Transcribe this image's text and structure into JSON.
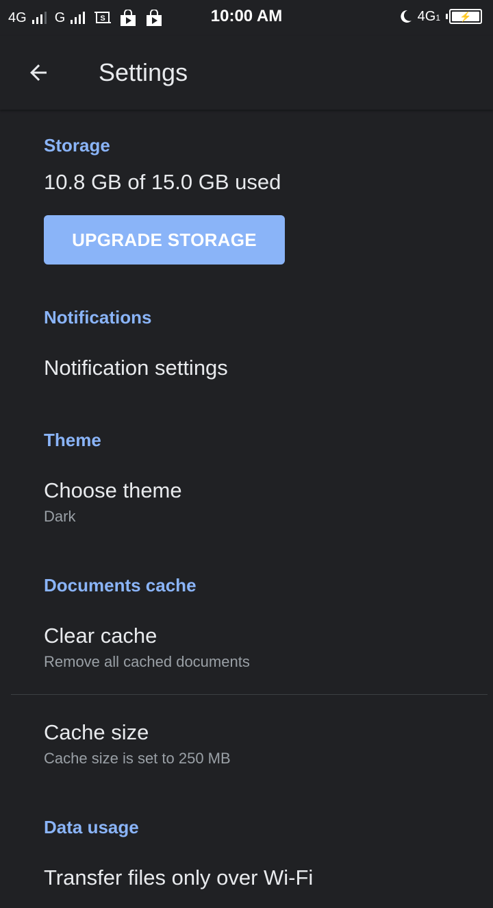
{
  "status_bar": {
    "network1": "4G",
    "network2": "G",
    "time": "10:00 AM",
    "network3": "4G",
    "sim_index": "1",
    "icons": [
      "signal-icon",
      "screenshot-icon",
      "play-store-icon",
      "play-store-icon",
      "moon-icon",
      "battery-charging-icon"
    ]
  },
  "app_bar": {
    "title": "Settings",
    "back_icon": "arrow-back-icon"
  },
  "colors": {
    "background": "#202124",
    "accent": "#8ab4f8",
    "primary_text": "#e8eaed",
    "secondary_text": "#9aa0a6"
  },
  "sections": {
    "storage": {
      "header": "Storage",
      "usage": "10.8 GB of 15.0 GB used",
      "button": "UPGRADE STORAGE"
    },
    "notifications": {
      "header": "Notifications",
      "item": "Notification settings"
    },
    "theme": {
      "header": "Theme",
      "item": "Choose theme",
      "value": "Dark"
    },
    "documents_cache": {
      "header": "Documents cache",
      "clear_title": "Clear cache",
      "clear_sub": "Remove all cached documents",
      "size_title": "Cache size",
      "size_sub": "Cache size is set to 250 MB"
    },
    "data_usage": {
      "header": "Data usage",
      "item": "Transfer files only over Wi-Fi"
    }
  }
}
